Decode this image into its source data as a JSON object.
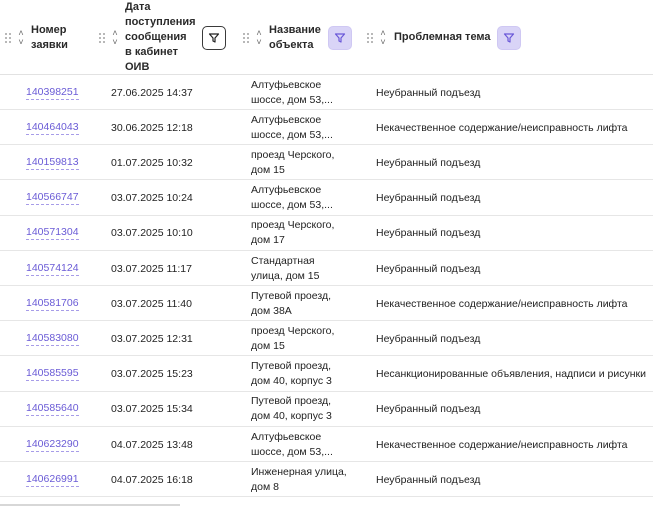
{
  "headers": {
    "number": "Номер\nзаявки",
    "date": "Дата\nпоступления\nсообщения\nв кабинет\nОИВ",
    "object": "Название\nобъекта",
    "topic": "Проблемная тема"
  },
  "icons": {
    "drag": "drag-handle-icon",
    "sort": "sort-arrows-icon",
    "filter": "filter-icon"
  },
  "colors": {
    "link": "#6a5bd6",
    "filter_active_bg": "#d9d4f7",
    "filter_active_fg": "#6a58d8"
  },
  "rows": [
    {
      "number": "140398251",
      "date": "27.06.2025 14:37",
      "object": "Алтуфьевское\nшоссе, дом 53,...",
      "topic": "Неубранный подъезд"
    },
    {
      "number": "140464043",
      "date": "30.06.2025 12:18",
      "object": "Алтуфьевское\nшоссе, дом 53,...",
      "topic": "Некачественное содержание/неисправность лифта"
    },
    {
      "number": "140159813",
      "date": "01.07.2025 10:32",
      "object": "проезд Черского,\nдом 15",
      "topic": "Неубранный подъезд"
    },
    {
      "number": "140566747",
      "date": "03.07.2025 10:24",
      "object": "Алтуфьевское\nшоссе, дом 53,...",
      "topic": "Неубранный подъезд"
    },
    {
      "number": "140571304",
      "date": "03.07.2025 10:10",
      "object": "проезд Черского,\nдом 17",
      "topic": "Неубранный подъезд"
    },
    {
      "number": "140574124",
      "date": "03.07.2025 11:17",
      "object": "Стандартная\nулица, дом 15",
      "topic": "Неубранный подъезд"
    },
    {
      "number": "140581706",
      "date": "03.07.2025 11:40",
      "object": "Путевой проезд,\nдом 38А",
      "topic": "Некачественное содержание/неисправность лифта"
    },
    {
      "number": "140583080",
      "date": "03.07.2025 12:31",
      "object": "проезд Черского,\nдом 15",
      "topic": "Неубранный подъезд"
    },
    {
      "number": "140585595",
      "date": "03.07.2025 15:23",
      "object": "Путевой проезд,\nдом 40, корпус 3",
      "topic": "Несанкционированные объявления, надписи и рисунки"
    },
    {
      "number": "140585640",
      "date": "03.07.2025 15:34",
      "object": "Путевой проезд,\nдом 40, корпус 3",
      "topic": "Неубранный подъезд"
    },
    {
      "number": "140623290",
      "date": "04.07.2025 13:48",
      "object": "Алтуфьевское\nшоссе, дом 53,...",
      "topic": "Некачественное содержание/неисправность лифта"
    },
    {
      "number": "140626991",
      "date": "04.07.2025 16:18",
      "object": "Инженерная улица,\nдом 8",
      "topic": "Неубранный подъезд"
    }
  ]
}
